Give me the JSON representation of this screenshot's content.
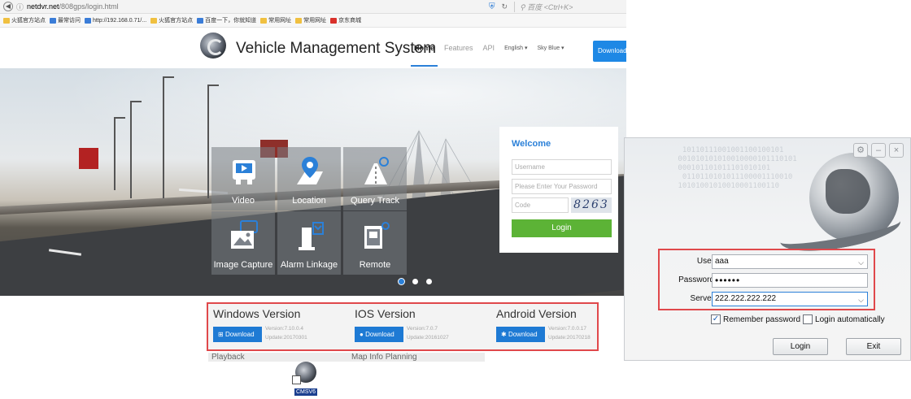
{
  "browser": {
    "url_host": "netdvr.net",
    "url_path": "/808gps/login.html",
    "search_placeholder": "百度 <Ctrl+K>",
    "bookmarks": [
      "火狐官方站点",
      "最常访问",
      "http://192.168.0.71/...",
      "火狐官方站点",
      "百度一下，你就知道",
      "常用网址",
      "常用网址",
      "京东商城"
    ]
  },
  "site": {
    "title": "Vehicle Management System",
    "nav": {
      "home": "Home",
      "features": "Features",
      "api": "API",
      "language": "English ▾",
      "theme": "Sky Blue ▾",
      "download": "Download"
    },
    "tiles": [
      {
        "label": "Video",
        "icon": "video-icon"
      },
      {
        "label": "Location",
        "icon": "location-pin-icon"
      },
      {
        "label": "Query Track",
        "icon": "track-icon"
      },
      {
        "label": "Image Capture",
        "icon": "image-capture-icon"
      },
      {
        "label": "Alarm Linkage",
        "icon": "alarm-icon"
      },
      {
        "label": "Remote",
        "icon": "remote-icon"
      }
    ],
    "login": {
      "title": "Welcome",
      "username_placeholder": "Username",
      "password_placeholder": "Please Enter Your Password",
      "code_placeholder": "Code",
      "captcha": "8263",
      "button": "Login"
    },
    "downloads": [
      {
        "name": "Windows Version",
        "button": "Download",
        "version": "Version:7.10.0.4",
        "update": "Update:20170301"
      },
      {
        "name": "IOS Version",
        "button": "Download",
        "version": "Version:7.0.7",
        "update": "Update:20161027"
      },
      {
        "name": "Android Version",
        "button": "Download",
        "version": "Version:7.0.0.17",
        "update": "Update:20170218"
      }
    ],
    "below": [
      "Playback",
      "Map Info Planning"
    ]
  },
  "desktop": {
    "shortcut_label": "CMSV6"
  },
  "client": {
    "binary_text": "  10110111001001100100101\n 001010101010010000101110101\n 000101101011101010101\n  0110110101011100001110010\n 10101001010010001100110",
    "user_label": "User",
    "user_value": "aaa",
    "password_label": "Password",
    "password_value": "••••••",
    "server_label": "Server",
    "server_value": "222.222.222.222",
    "remember_label": "Remember password",
    "remember_checked": "✓",
    "auto_login_label": "Login automatically",
    "login_button": "Login",
    "exit_button": "Exit"
  },
  "colors": {
    "accent": "#2b80d8",
    "login_green": "#5cb336",
    "highlight_red": "#e0484b",
    "download_blue": "#1e7ad4"
  }
}
